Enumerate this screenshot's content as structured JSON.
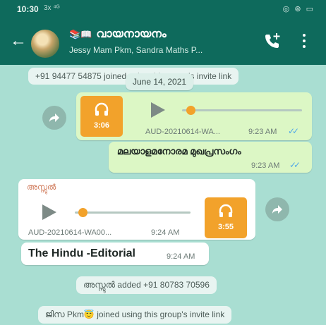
{
  "status_bar": {
    "time": "10:30",
    "extra": "3x ⁴ᴳ",
    "icons": "◎ ⊛ ▭"
  },
  "header": {
    "emoji": "📚📖",
    "group_name": "വായനായനം",
    "members": "Jessy Mam Pkm, Sandra Maths P..."
  },
  "messages": {
    "system_top": "+91 94477 54875 joined using this group's invite link",
    "date_chip": "June 14, 2021",
    "audio_out": {
      "duration": "3:06",
      "file": "AUD-20210614-WA...",
      "time": "9:23 AM",
      "progress": 0.08
    },
    "text_out": {
      "text": "മലയാളമനോരമ മുഖപ്രസംഗം",
      "time": "9:23 AM"
    },
    "audio_in": {
      "sender": "അസ്സുൽ",
      "duration": "3:55",
      "file": "AUD-20210614-WA00...",
      "time": "9:24 AM",
      "progress": 0.08
    },
    "text_in": {
      "text": "The Hindu -Editorial",
      "time": "9:24 AM"
    },
    "system_added": "അസ്സുൽ added +91 80783 70596",
    "system_joined": "ജിസ Pkm😇 joined using this group's invite link"
  },
  "colors": {
    "header": "#0e6a5c",
    "wallpaper": "#a9ded2",
    "outgoing": "#dcf7c5",
    "audio_accent": "#f2a22b"
  }
}
